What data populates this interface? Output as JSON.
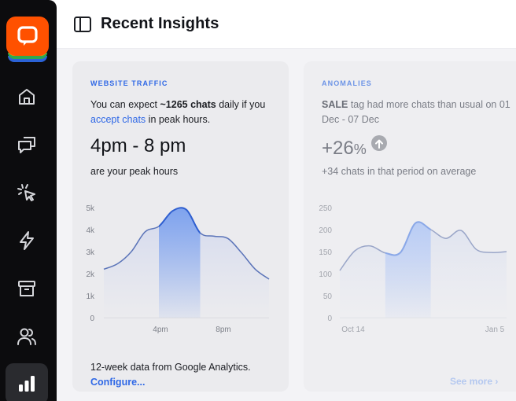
{
  "header": {
    "title": "Recent Insights"
  },
  "sidebar": {
    "items": [
      {
        "name": "home"
      },
      {
        "name": "chats"
      },
      {
        "name": "engage"
      },
      {
        "name": "automate"
      },
      {
        "name": "archives"
      },
      {
        "name": "team"
      },
      {
        "name": "reports",
        "active": true
      }
    ]
  },
  "traffic_card": {
    "eyebrow": "WEBSITE TRAFFIC",
    "desc_pre": "You can expect ",
    "desc_bold": "~1265 chats",
    "desc_mid": " daily if you ",
    "desc_link": "accept chats",
    "desc_post": " in peak hours.",
    "peak": "4pm - 8 pm",
    "peak_sub": "are your peak hours",
    "footer": "12-week data from Google Analytics.",
    "footer_link": "Configure..."
  },
  "anomalies_card": {
    "eyebrow": "ANOMALIES",
    "desc_bold": "SALE",
    "desc_rest": " tag had more chats than usual on 01 Dec - 07 Dec",
    "value": "+26",
    "value_unit": "%",
    "value_sub": "+34 chats in that period on average",
    "see_more": "See more"
  },
  "chart_data": [
    {
      "type": "area",
      "ylim": [
        0,
        5000
      ],
      "yticks": [
        "0",
        "1k",
        "2k",
        "3k",
        "4k",
        "5k"
      ],
      "xticks": [
        "4pm",
        "8pm"
      ],
      "x": [
        0,
        1,
        2,
        3,
        4,
        5,
        6,
        7,
        8,
        9,
        10,
        11,
        12
      ],
      "values": [
        2200,
        2450,
        3000,
        3900,
        4150,
        4850,
        4900,
        3850,
        3700,
        3600,
        2950,
        2200,
        1750
      ],
      "highlight": [
        4,
        7
      ],
      "colors": {
        "line": "#5b74b8",
        "highlight_line": "#2f5fd0",
        "highlight_fill": "#7aa0ee"
      }
    },
    {
      "type": "area",
      "ylim": [
        0,
        250
      ],
      "yticks": [
        "0",
        "50",
        "100",
        "150",
        "200",
        "250"
      ],
      "xticks": [
        "Oct 14",
        "Jan 5"
      ],
      "x": [
        0,
        1,
        2,
        3,
        4,
        5,
        6,
        7,
        8,
        9,
        10,
        11
      ],
      "values": [
        107,
        152,
        163,
        147,
        148,
        215,
        200,
        180,
        198,
        155,
        148,
        150
      ],
      "highlight": [
        3,
        6
      ],
      "colors": {
        "line": "#9aa6c8",
        "highlight_line": "#8aa8e8",
        "highlight_fill": "#b7cbf5"
      }
    }
  ]
}
